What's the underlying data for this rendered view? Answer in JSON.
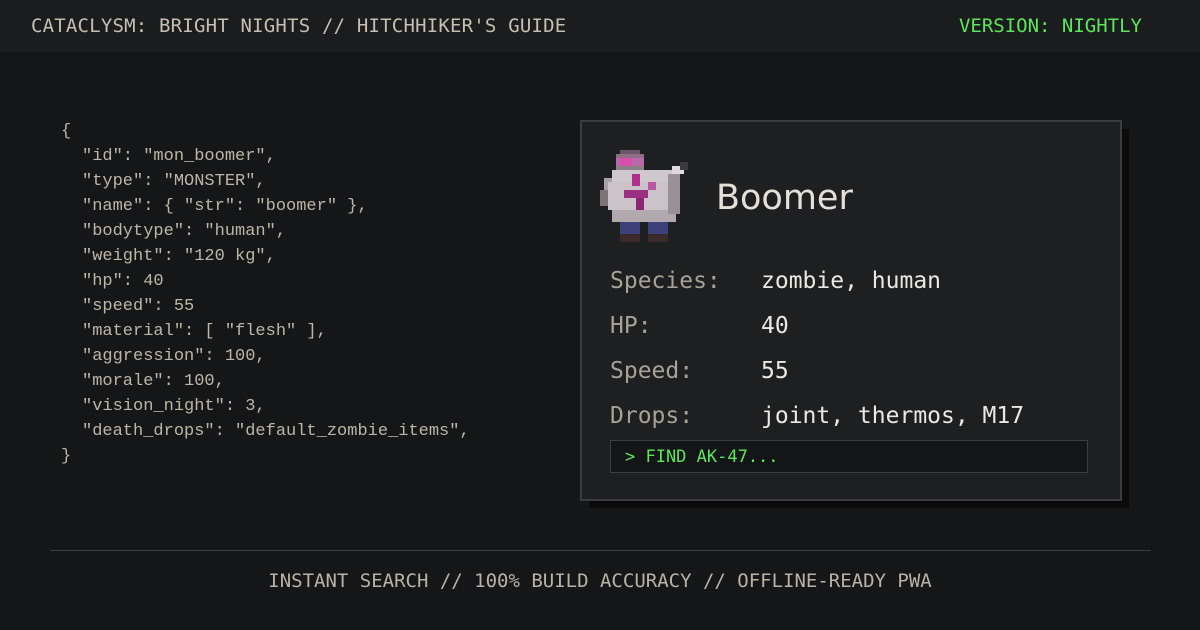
{
  "header": {
    "title": "CATACLYSM: BRIGHT NIGHTS // HITCHHIKER'S GUIDE",
    "version": "VERSION: NIGHTLY"
  },
  "json_view": {
    "lines": [
      "{",
      "\"id\": \"mon_boomer\",",
      "\"type\": \"MONSTER\",",
      "\"name\": { \"str\": \"boomer\" },",
      "\"bodytype\": \"human\",",
      "\"weight\": \"120 kg\",",
      "\"hp\": 40",
      "\"speed\": 55",
      "\"material\": [ \"flesh\" ],",
      "\"aggression\": 100,",
      "\"morale\": 100,",
      "\"vision_night\": 3,",
      "\"death_drops\": \"default_zombie_items\",",
      "}"
    ]
  },
  "card": {
    "name": "Boomer",
    "sprite_icon": "boomer-zombie-sprite",
    "stats": [
      {
        "label": "Species:",
        "value": "zombie, human"
      },
      {
        "label": "HP:",
        "value": "40"
      },
      {
        "label": "Speed:",
        "value": "55"
      },
      {
        "label": "Drops:",
        "value": "joint, thermos, M17"
      }
    ],
    "find_prompt": "> FIND AK-47..."
  },
  "footer": {
    "tagline": "INSTANT SEARCH // 100% BUILD ACCURACY // OFFLINE-READY PWA"
  },
  "colors": {
    "background": "#151617",
    "accent_green": "#5ce65c",
    "card_bg": "#1d1f21"
  }
}
